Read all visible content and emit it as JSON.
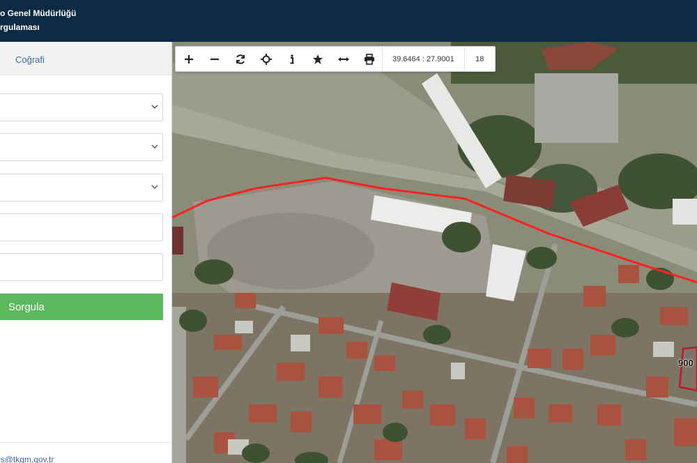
{
  "header": {
    "line1": "o Genel Müdürlüğü",
    "line2": "rgulaması"
  },
  "sidebar": {
    "tab_back_icon": "chevron-left-icon",
    "tab_geo_label": "Coğrafi",
    "fields": [
      {
        "type": "select",
        "value": ""
      },
      {
        "type": "select",
        "value": ""
      },
      {
        "type": "select",
        "value": ""
      },
      {
        "type": "input",
        "value": "",
        "placeholder": ""
      },
      {
        "type": "input",
        "value": "",
        "placeholder": ""
      }
    ],
    "query_button_label": "Sorgula",
    "footer_email": "ps@tkgm.gov.tr"
  },
  "map": {
    "toolbar": {
      "buttons": [
        "zoom-in-icon",
        "zoom-out-icon",
        "refresh-icon",
        "locate-icon",
        "info-icon",
        "favorite-star-icon",
        "measure-icon",
        "print-icon"
      ],
      "coordinates": "39.6464 : 27.9001",
      "zoom_level": "18"
    },
    "parcel_label": "900",
    "colors": {
      "boundary": "#ff2020",
      "parcel": "#c0182a"
    }
  },
  "colors": {
    "header_bg": "#0e2a45",
    "accent_green": "#5cb85c",
    "link_blue": "#3b6aa3"
  }
}
